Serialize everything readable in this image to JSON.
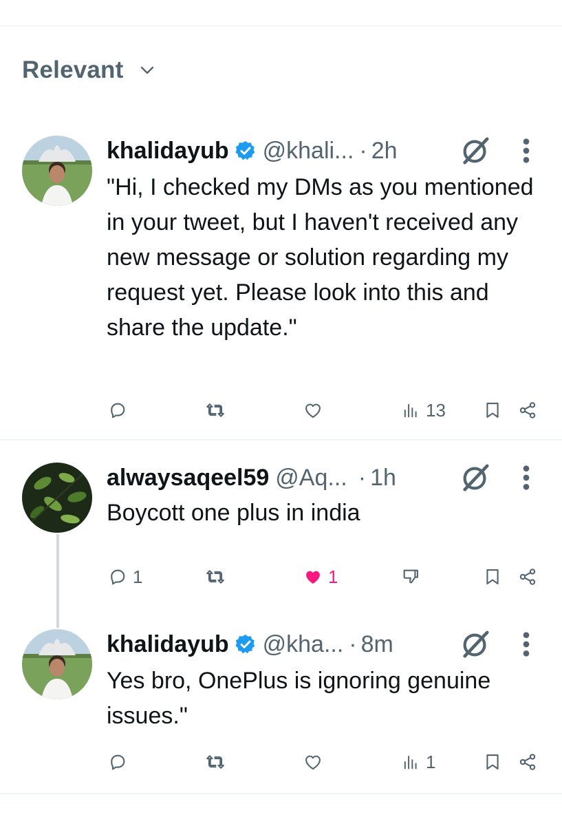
{
  "sort": {
    "label": "Relevant"
  },
  "tweets": [
    {
      "name": "khalidayub",
      "handle": "@khali...",
      "dot": "·",
      "time": "2h",
      "text": "\"Hi, I checked my DMs as you mentioned in your tweet, but I haven't received any new message or solution regarding my request yet. Please look into this and share the update.\"",
      "verified": true,
      "actions": {
        "replies": "",
        "reposts": "",
        "likes": "",
        "views": "13"
      }
    },
    {
      "name": "alwaysaqeel59",
      "handle": "@Aq...",
      "dot": "·",
      "time": "1h",
      "text": "Boycott one plus in india",
      "verified": false,
      "actions": {
        "replies": "1",
        "reposts": "",
        "likes": "1",
        "dislike": ""
      }
    },
    {
      "name": "khalidayub",
      "handle": "@kha...",
      "dot": "·",
      "time": "8m",
      "text": "Yes bro, OnePlus is ignoring genuine issues.\"",
      "verified": true,
      "actions": {
        "replies": "",
        "reposts": "",
        "likes": "",
        "views": "1"
      }
    }
  ],
  "colors": {
    "verified": "#1d9bf0",
    "like_active": "#f91880",
    "secondary_text": "#536471"
  },
  "icons": [
    "chevron-down-icon",
    "verified-badge-icon",
    "grok-icon",
    "more-icon",
    "reply-icon",
    "repost-icon",
    "like-icon",
    "views-icon",
    "dislike-icon",
    "bookmark-icon",
    "share-icon"
  ]
}
